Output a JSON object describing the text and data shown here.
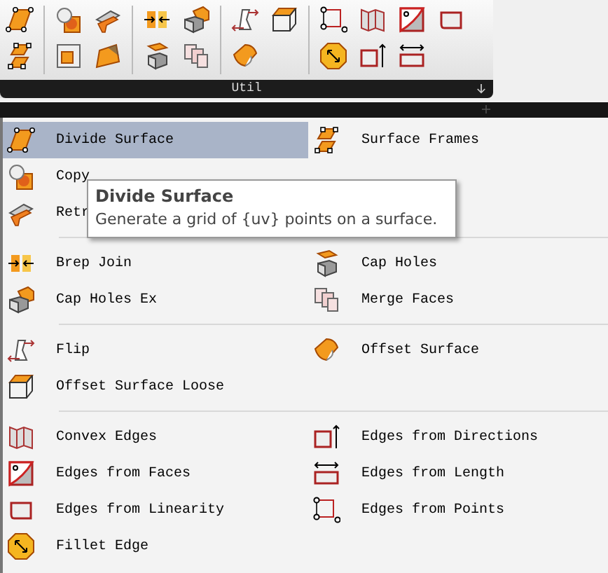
{
  "toolbar": {
    "title": "Util"
  },
  "menu": {
    "sections": [
      {
        "left": [
          {
            "label": "Divide Surface",
            "selected": true
          },
          {
            "label": "Copy",
            "selected": false
          },
          {
            "label": "Retr",
            "selected": false
          }
        ],
        "right": [
          {
            "label": "Surface Frames",
            "selected": false
          }
        ]
      },
      {
        "left": [
          {
            "label": "Brep Join",
            "selected": false
          },
          {
            "label": "Cap Holes Ex",
            "selected": false
          }
        ],
        "right": [
          {
            "label": "Cap Holes",
            "selected": false
          },
          {
            "label": "Merge Faces",
            "selected": false
          }
        ]
      },
      {
        "left": [
          {
            "label": "Flip",
            "selected": false
          },
          {
            "label": "Offset Surface Loose",
            "selected": false
          }
        ],
        "right": [
          {
            "label": "Offset Surface",
            "selected": false
          }
        ]
      },
      {
        "left": [
          {
            "label": "Convex Edges",
            "selected": false
          },
          {
            "label": "Edges from Faces",
            "selected": false
          },
          {
            "label": "Edges from Linearity",
            "selected": false
          },
          {
            "label": "Fillet Edge",
            "selected": false
          }
        ],
        "right": [
          {
            "label": "Edges from Directions",
            "selected": false
          },
          {
            "label": "Edges from Length",
            "selected": false
          },
          {
            "label": "Edges from Points",
            "selected": false
          }
        ]
      }
    ]
  },
  "tooltip": {
    "title": "Divide Surface",
    "text": "Generate a grid of {uv} points on a surface."
  }
}
